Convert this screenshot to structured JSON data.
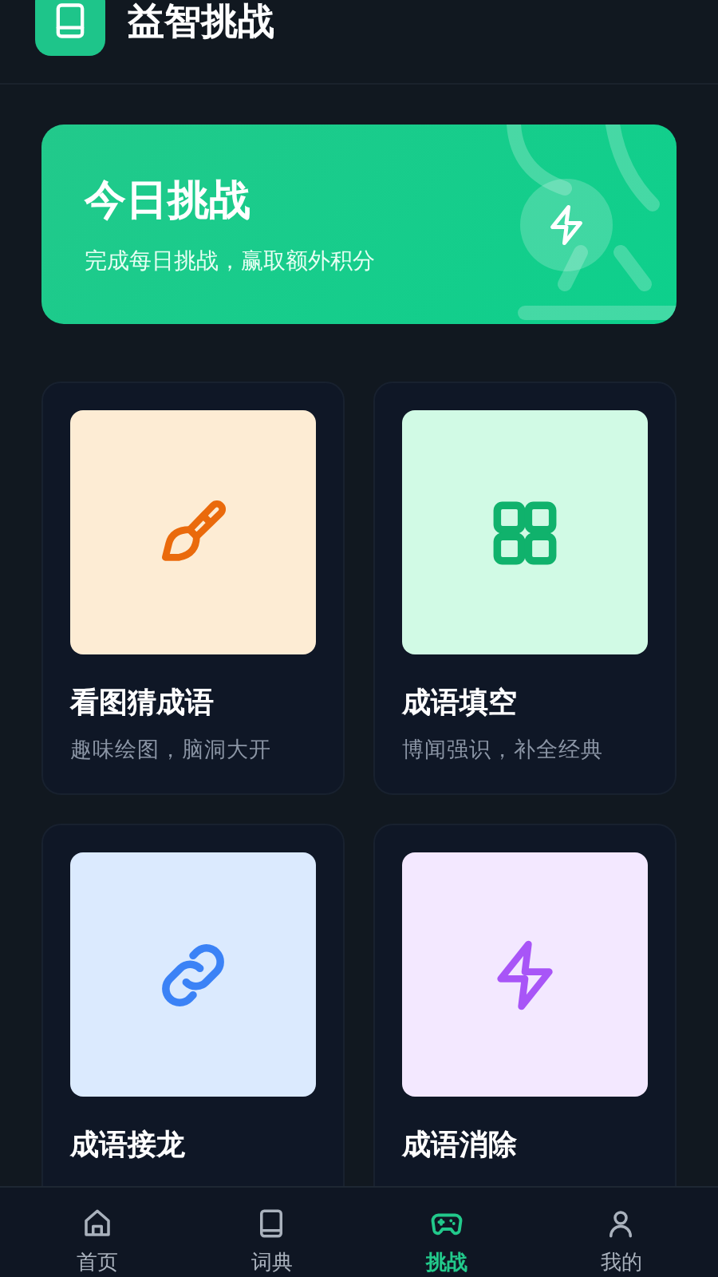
{
  "header": {
    "title": "益智挑战"
  },
  "banner": {
    "title": "今日挑战",
    "subtitle": "完成每日挑战，赢取额外积分"
  },
  "games": [
    {
      "kind": "brush",
      "title": "看图猜成语",
      "subtitle": "趣味绘图，脑洞大开",
      "color": "#fdecd4"
    },
    {
      "kind": "grid",
      "title": "成语填空",
      "subtitle": "博闻强识，补全经典",
      "color": "#d1fae5"
    },
    {
      "kind": "link",
      "title": "成语接龙",
      "color": "#dbeafe"
    },
    {
      "kind": "bolt",
      "title": "成语消除",
      "color": "#f3e8ff"
    }
  ],
  "nav": [
    {
      "kind": "home",
      "label": "首页",
      "selected": false
    },
    {
      "kind": "book",
      "label": "词典",
      "selected": false
    },
    {
      "kind": "gamepad",
      "label": "挑战",
      "selected": true
    },
    {
      "kind": "user",
      "label": "我的",
      "selected": false
    }
  ]
}
